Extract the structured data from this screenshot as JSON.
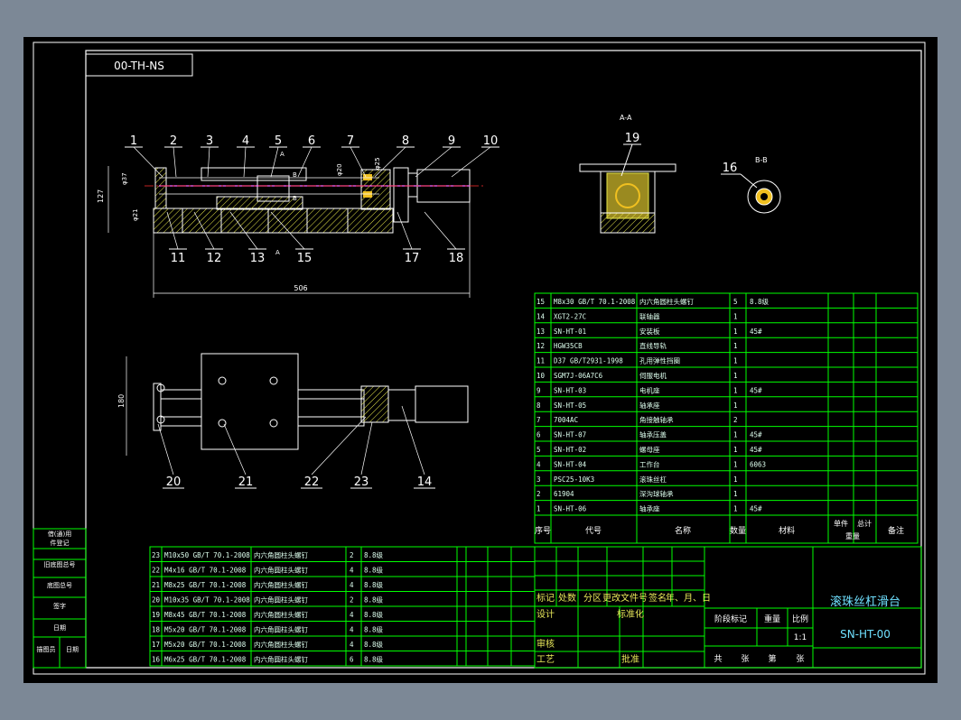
{
  "drawing_code_box": "00-TH-NS",
  "section_labels": {
    "aa": "A-A",
    "bb": "B-B",
    "mark_a_top": "A",
    "mark_a_bottom": "A",
    "mark_b_top": "B",
    "mark_b_bottom": "B"
  },
  "balloons_front": [
    "1",
    "2",
    "3",
    "4",
    "5",
    "6",
    "7",
    "8",
    "9",
    "10",
    "11",
    "12",
    "13",
    "15",
    "17",
    "18"
  ],
  "balloon_section_a": "19",
  "balloon_section_b": "16",
  "balloons_top": [
    "20",
    "21",
    "22",
    "23",
    "14"
  ],
  "dims": {
    "length": "506",
    "height": "127",
    "width": "180",
    "d1": "φ37",
    "d2": "φ20",
    "d3": "φ21",
    "d4": "φ25"
  },
  "parts_upper": [
    {
      "no": "15",
      "code": "M8x30 GB/T 70.1-2008",
      "name": "内六角圆柱头螺钉",
      "qty": "5",
      "mat": "8.8级"
    },
    {
      "no": "14",
      "code": "XGT2-27C",
      "name": "联轴器",
      "qty": "1",
      "mat": ""
    },
    {
      "no": "13",
      "code": "SN-HT-01",
      "name": "安装板",
      "qty": "1",
      "mat": "45#"
    },
    {
      "no": "12",
      "code": "HGW35CB",
      "name": "直线导轨",
      "qty": "1",
      "mat": ""
    },
    {
      "no": "11",
      "code": "D37 GB/T2931-1998",
      "name": "孔用弹性挡圈",
      "qty": "1",
      "mat": ""
    },
    {
      "no": "10",
      "code": "SGM7J-06A7C6",
      "name": "伺服电机",
      "qty": "1",
      "mat": ""
    },
    {
      "no": "9",
      "code": "SN-HT-03",
      "name": "电机座",
      "qty": "1",
      "mat": "45#"
    },
    {
      "no": "8",
      "code": "SN-HT-05",
      "name": "轴承座",
      "qty": "1",
      "mat": ""
    },
    {
      "no": "7",
      "code": "7004AC",
      "name": "角接触轴承",
      "qty": "2",
      "mat": ""
    },
    {
      "no": "6",
      "code": "SN-HT-07",
      "name": "轴承压盖",
      "qty": "1",
      "mat": "45#"
    },
    {
      "no": "5",
      "code": "SN-HT-02",
      "name": "螺母座",
      "qty": "1",
      "mat": "45#"
    },
    {
      "no": "4",
      "code": "SN-HT-04",
      "name": "工作台",
      "qty": "1",
      "mat": "6063"
    },
    {
      "no": "3",
      "code": "PSC25-10K3",
      "name": "滚珠丝杠",
      "qty": "1",
      "mat": ""
    },
    {
      "no": "2",
      "code": "61904",
      "name": "深沟球轴承",
      "qty": "1",
      "mat": ""
    },
    {
      "no": "1",
      "code": "SN-HT-06",
      "name": "轴承座",
      "qty": "1",
      "mat": "45#"
    }
  ],
  "parts_header": {
    "no": "序号",
    "code": "代号",
    "name": "名称",
    "qty": "数量",
    "mat": "材料",
    "single": "单件",
    "total": "总计",
    "weight": "重量",
    "remark": "备注"
  },
  "parts_lower": [
    {
      "no": "23",
      "code": "M10x50 GB/T 70.1-2008",
      "name": "内六角圆柱头螺钉",
      "qty": "2",
      "mat": "8.8级"
    },
    {
      "no": "22",
      "code": "M4x16 GB/T 70.1-2008",
      "name": "内六角圆柱头螺钉",
      "qty": "4",
      "mat": "8.8级"
    },
    {
      "no": "21",
      "code": "M8x25 GB/T 70.1-2008",
      "name": "内六角圆柱头螺钉",
      "qty": "4",
      "mat": "8.8级"
    },
    {
      "no": "20",
      "code": "M10x35 GB/T 70.1-2008",
      "name": "内六角圆柱头螺钉",
      "qty": "2",
      "mat": "8.8级"
    },
    {
      "no": "19",
      "code": "M8x45 GB/T 70.1-2008",
      "name": "内六角圆柱头螺钉",
      "qty": "4",
      "mat": "8.8级"
    },
    {
      "no": "18",
      "code": "M5x20 GB/T 70.1-2008",
      "name": "内六角圆柱头螺钉",
      "qty": "4",
      "mat": "8.8级"
    },
    {
      "no": "17",
      "code": "M5x20 GB/T 70.1-2008",
      "name": "内六角圆柱头螺钉",
      "qty": "4",
      "mat": "8.8级"
    },
    {
      "no": "16",
      "code": "M6x25 GB/T 70.1-2008",
      "name": "内六角圆柱头螺钉",
      "qty": "6",
      "mat": "8.8级"
    }
  ],
  "left_strip": [
    "借(通)用",
    "件登记",
    "旧底图总号",
    "底图总号",
    "签字",
    "日期",
    "描图员",
    "日期"
  ],
  "title_block": {
    "title": "滚珠丝杠滑台",
    "drawing_no": "SN-HT-00",
    "scale": "1:1",
    "labels": {
      "mark": "标记",
      "count": "处数",
      "zone": "分区",
      "change_doc": "更改文件号",
      "sign": "签名",
      "date": "年、月、日",
      "design": "设计",
      "standard": "标准化",
      "review": "审核",
      "process": "工艺",
      "approve": "批准",
      "stage_mark": "阶段标记",
      "weight": "重量",
      "scale_label": "比例",
      "sheets_total": "共",
      "sheets_unit": "张",
      "sheet_no": "第",
      "sheet_unit2": "张"
    }
  },
  "colors": {
    "background": "#7c8896",
    "sheet": "#000000",
    "frame": "#ffffff",
    "table": "#00ff00",
    "text": "#ffffff",
    "hatch": "#ffff00",
    "centerline": "#ff3030",
    "shaft": "#ff66ff",
    "dim": "#ffffff"
  }
}
